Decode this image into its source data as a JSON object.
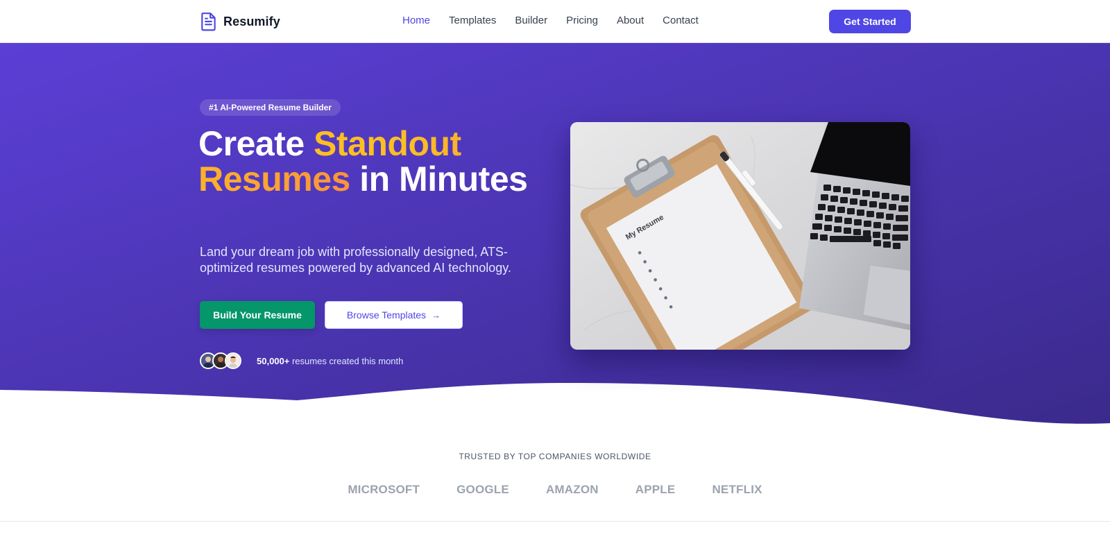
{
  "nav": {
    "brand": "Resumify",
    "links": [
      "Home",
      "Templates",
      "Builder",
      "Pricing",
      "About",
      "Contact"
    ],
    "active": "Home",
    "cta": "Get Started"
  },
  "hero": {
    "badge": "#1 AI-Powered Resume Builder",
    "headline": {
      "part1": "Create ",
      "accent": "Standout Resumes",
      "part2": " in Minutes"
    },
    "subtext": "Land your dream job with professionally designed, ATS-optimized resumes powered by advanced AI technology.",
    "primary_button": "Build Your Resume",
    "secondary_button": "Browse Templates",
    "social_proof": {
      "count": "50,000+",
      "text": " resumes created this month"
    },
    "image_text": "My Resume"
  },
  "trusted": {
    "title": "TRUSTED BY TOP COMPANIES WORLDWIDE",
    "logos": [
      "MICROSOFT",
      "GOOGLE",
      "AMAZON",
      "APPLE",
      "NETFLIX"
    ]
  },
  "colors": {
    "brand": "#4f46e5",
    "hero_gradient_start": "#5b3fd6",
    "hero_gradient_end": "#3b2a8c",
    "accent_yellow": "#fbbf24",
    "accent_orange": "#fb923c",
    "primary_button": "#059669"
  }
}
